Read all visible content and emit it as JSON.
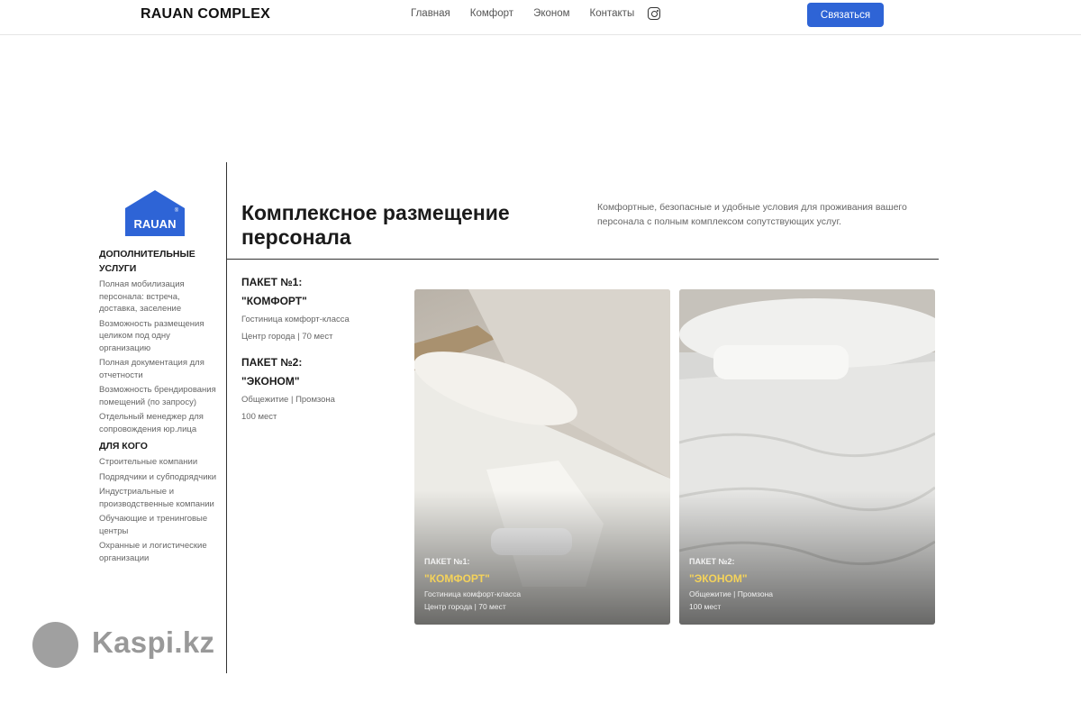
{
  "header": {
    "brand": "RAUAN COMPLEX",
    "nav": [
      "Главная",
      "Комфорт",
      "Эконом",
      "Контакты"
    ],
    "instagram_icon": "instagram-icon",
    "cta_label": "Связаться",
    "accent_color": "#2e64d6"
  },
  "sidebar": {
    "logo_text": "RAUAN",
    "logo_mark": "®",
    "section1_title": "ДОПОЛНИТЕЛЬНЫЕ УСЛУГИ",
    "section1_items": [
      "Полная мобилизация персонала: встреча, доставка, заселение",
      "Возможность размещения целиком под одну организацию",
      "Полная документация для отчетности",
      "Возможность брендирования помещений (по запросу)",
      "Отдельный менеджер для сопровождения юр.лица"
    ],
    "section2_title": "ДЛЯ КОГО",
    "section2_items": [
      "Строительные компании",
      "Подрядчики и субподрядчики",
      "Индустриальные и производственные компании",
      "Обучающие и тренинговые центры",
      "Охранные и логистические организации"
    ]
  },
  "main": {
    "title": "Комплексное размещение персонала",
    "subtitle": "Комфортные, безопасные и удобные условия для проживания вашего персонала с полным комплексом сопутствующих услуг.",
    "packages": [
      {
        "label": "ПАКЕТ №1:",
        "name": "\"КОМФОРТ\"",
        "line1": "Гостиница комфорт-класса",
        "line2": "Центр города | 70 мест"
      },
      {
        "label": "ПАКЕТ №2:",
        "name": "\"ЭКОНОМ\"",
        "line1": "Общежитие | Промзона",
        "line2": "100 мест"
      }
    ],
    "cards": [
      {
        "label": "ПАКЕТ №1:",
        "name": "\"КОМФОРТ\"",
        "line1": "Гостиница комфорт-класса",
        "line2": "Центр города | 70 мест"
      },
      {
        "label": "ПАКЕТ №2:",
        "name": "\"ЭКОНОМ\"",
        "line1": "Общежитие | Промзона",
        "line2": "100 мест"
      }
    ],
    "card_name_color": "#f5d35a"
  },
  "watermark": {
    "text": "Kaspi.kz",
    "icon": "kaspi-logo-icon"
  }
}
